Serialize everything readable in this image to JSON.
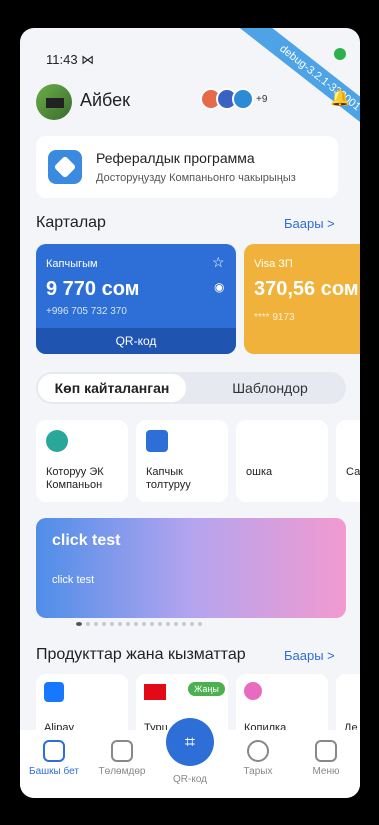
{
  "status": {
    "time": "11:43 ⋈"
  },
  "debug": {
    "text": "debug-3.2.1-333001"
  },
  "user": {
    "name": "Айбек",
    "coins_more": "+9"
  },
  "referral": {
    "title": "Рефералдык программа",
    "subtitle": "Досторуңузду Компаньонго чакырыңыз"
  },
  "cards": {
    "title": "Карталар",
    "all": "Баары >",
    "items": [
      {
        "label": "Капчыгым",
        "amount": "9 770 сом",
        "phone": "+996 705 732 370",
        "qr": "QR-код"
      },
      {
        "label": "Visa ЗП",
        "amount": "370,56 сом",
        "mask": "**** 9173"
      }
    ]
  },
  "tabs": {
    "active": "Көп кайталанган",
    "inactive": "Шаблондор"
  },
  "services": [
    {
      "label": "Которуу ЭК Компаньон"
    },
    {
      "label": "Капчык толтуруу"
    },
    {
      "label": "ошка"
    },
    {
      "label": "Са"
    }
  ],
  "banner": {
    "title": "click test",
    "subtitle": "click test"
  },
  "products": {
    "title": "Продукттар жана кызматтар",
    "all": "Баары >",
    "items": [
      {
        "label": "Alipay"
      },
      {
        "label": "Турц",
        "badge": "Жаңы"
      },
      {
        "label": "Копилка"
      },
      {
        "label": "Де"
      }
    ]
  },
  "nav": {
    "home": "Башкы бет",
    "payments": "Төлөмдөр",
    "qr": "QR-код",
    "history": "Тарых",
    "menu": "Меню"
  },
  "colors": {
    "accent": "#2d6fd6",
    "card_blue": "#2d6fd6",
    "card_yellow": "#f0b23a",
    "badge_green": "#4caf50"
  }
}
